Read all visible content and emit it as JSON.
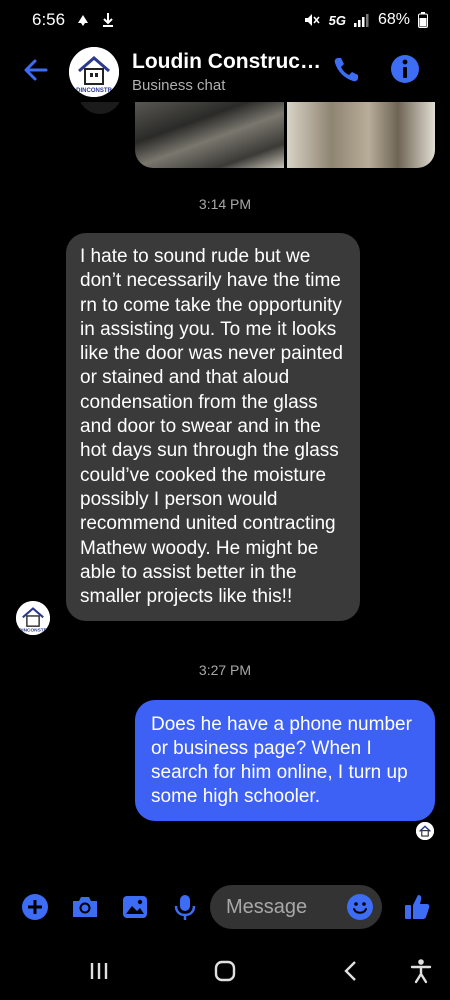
{
  "status_bar": {
    "time": "6:56",
    "network": "5G",
    "battery": "68%",
    "icons": [
      "facebook-notification-icon",
      "download-icon",
      "mute-icon",
      "signal-icon",
      "battery-icon"
    ]
  },
  "header": {
    "name": "Loudin Constructi...",
    "subtitle": "Business chat",
    "icons": [
      "back-arrow-icon",
      "phone-icon",
      "info-icon"
    ]
  },
  "messages": [
    {
      "type": "timestamp",
      "text": "3:14 PM"
    },
    {
      "type": "incoming",
      "text": "I hate to sound rude but we don’t necessarily have the time rn to come take the opportunity in assisting you. To me it looks like the door was never painted or stained and that aloud condensation from the glass and door to swear and in the hot days sun through the glass could’ve cooked the moisture possibly I person would recommend united contracting Mathew woody. He might be able to assist better in the smaller projects like this!!"
    },
    {
      "type": "timestamp",
      "text": "3:27 PM"
    },
    {
      "type": "outgoing",
      "text": "Does he have a phone number or business page? When I search for him online, I turn up some high schooler."
    }
  ],
  "composer": {
    "placeholder": "Message",
    "icons": [
      "plus-icon",
      "camera-icon",
      "gallery-icon",
      "mic-icon",
      "emoji-icon",
      "thumbs-up-icon"
    ]
  },
  "nav_bar": {
    "icons": [
      "recents-icon",
      "home-icon",
      "back-icon",
      "accessibility-icon"
    ]
  },
  "colors": {
    "accent": "#3d61f5",
    "incoming_bubble": "#3a3a3a",
    "background": "#000000",
    "icon_blue": "#3d6cf5"
  }
}
